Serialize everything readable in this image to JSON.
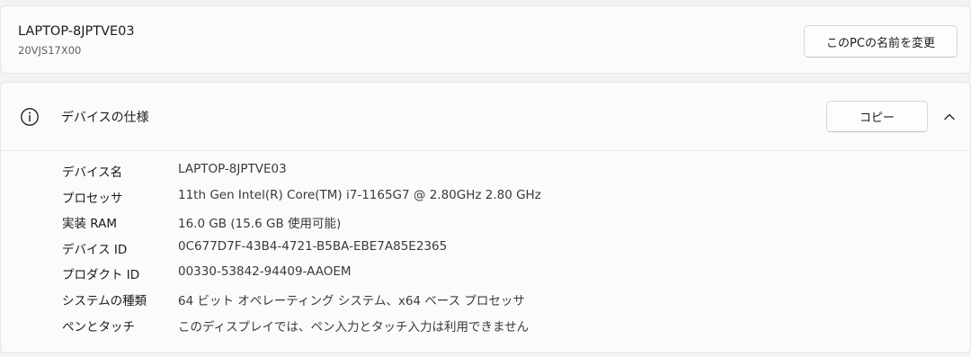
{
  "pc": {
    "name": "LAPTOP-8JPTVE03",
    "model": "20VJS17X00",
    "rename_label": "このPCの名前を変更"
  },
  "specs": {
    "title": "デバイスの仕様",
    "copy_label": "コピー",
    "rows": [
      {
        "key": "デバイス名",
        "value": "LAPTOP-8JPTVE03"
      },
      {
        "key": "プロセッサ",
        "value": "11th Gen Intel(R) Core(TM) i7-1165G7 @ 2.80GHz   2.80 GHz"
      },
      {
        "key": "実装 RAM",
        "value": "16.0 GB (15.6 GB 使用可能)"
      },
      {
        "key": "デバイス ID",
        "value": "0C677D7F-43B4-4721-B5BA-EBE7A85E2365"
      },
      {
        "key": "プロダクト ID",
        "value": "00330-53842-94409-AAOEM"
      },
      {
        "key": "システムの種類",
        "value": "64 ビット オペレーティング システム、x64 ベース プロセッサ"
      },
      {
        "key": "ペンとタッチ",
        "value": "このディスプレイでは、ペン入力とタッチ入力は利用できません"
      }
    ]
  },
  "icons": {
    "info": "info-icon",
    "collapse": "chevron-up-icon"
  }
}
